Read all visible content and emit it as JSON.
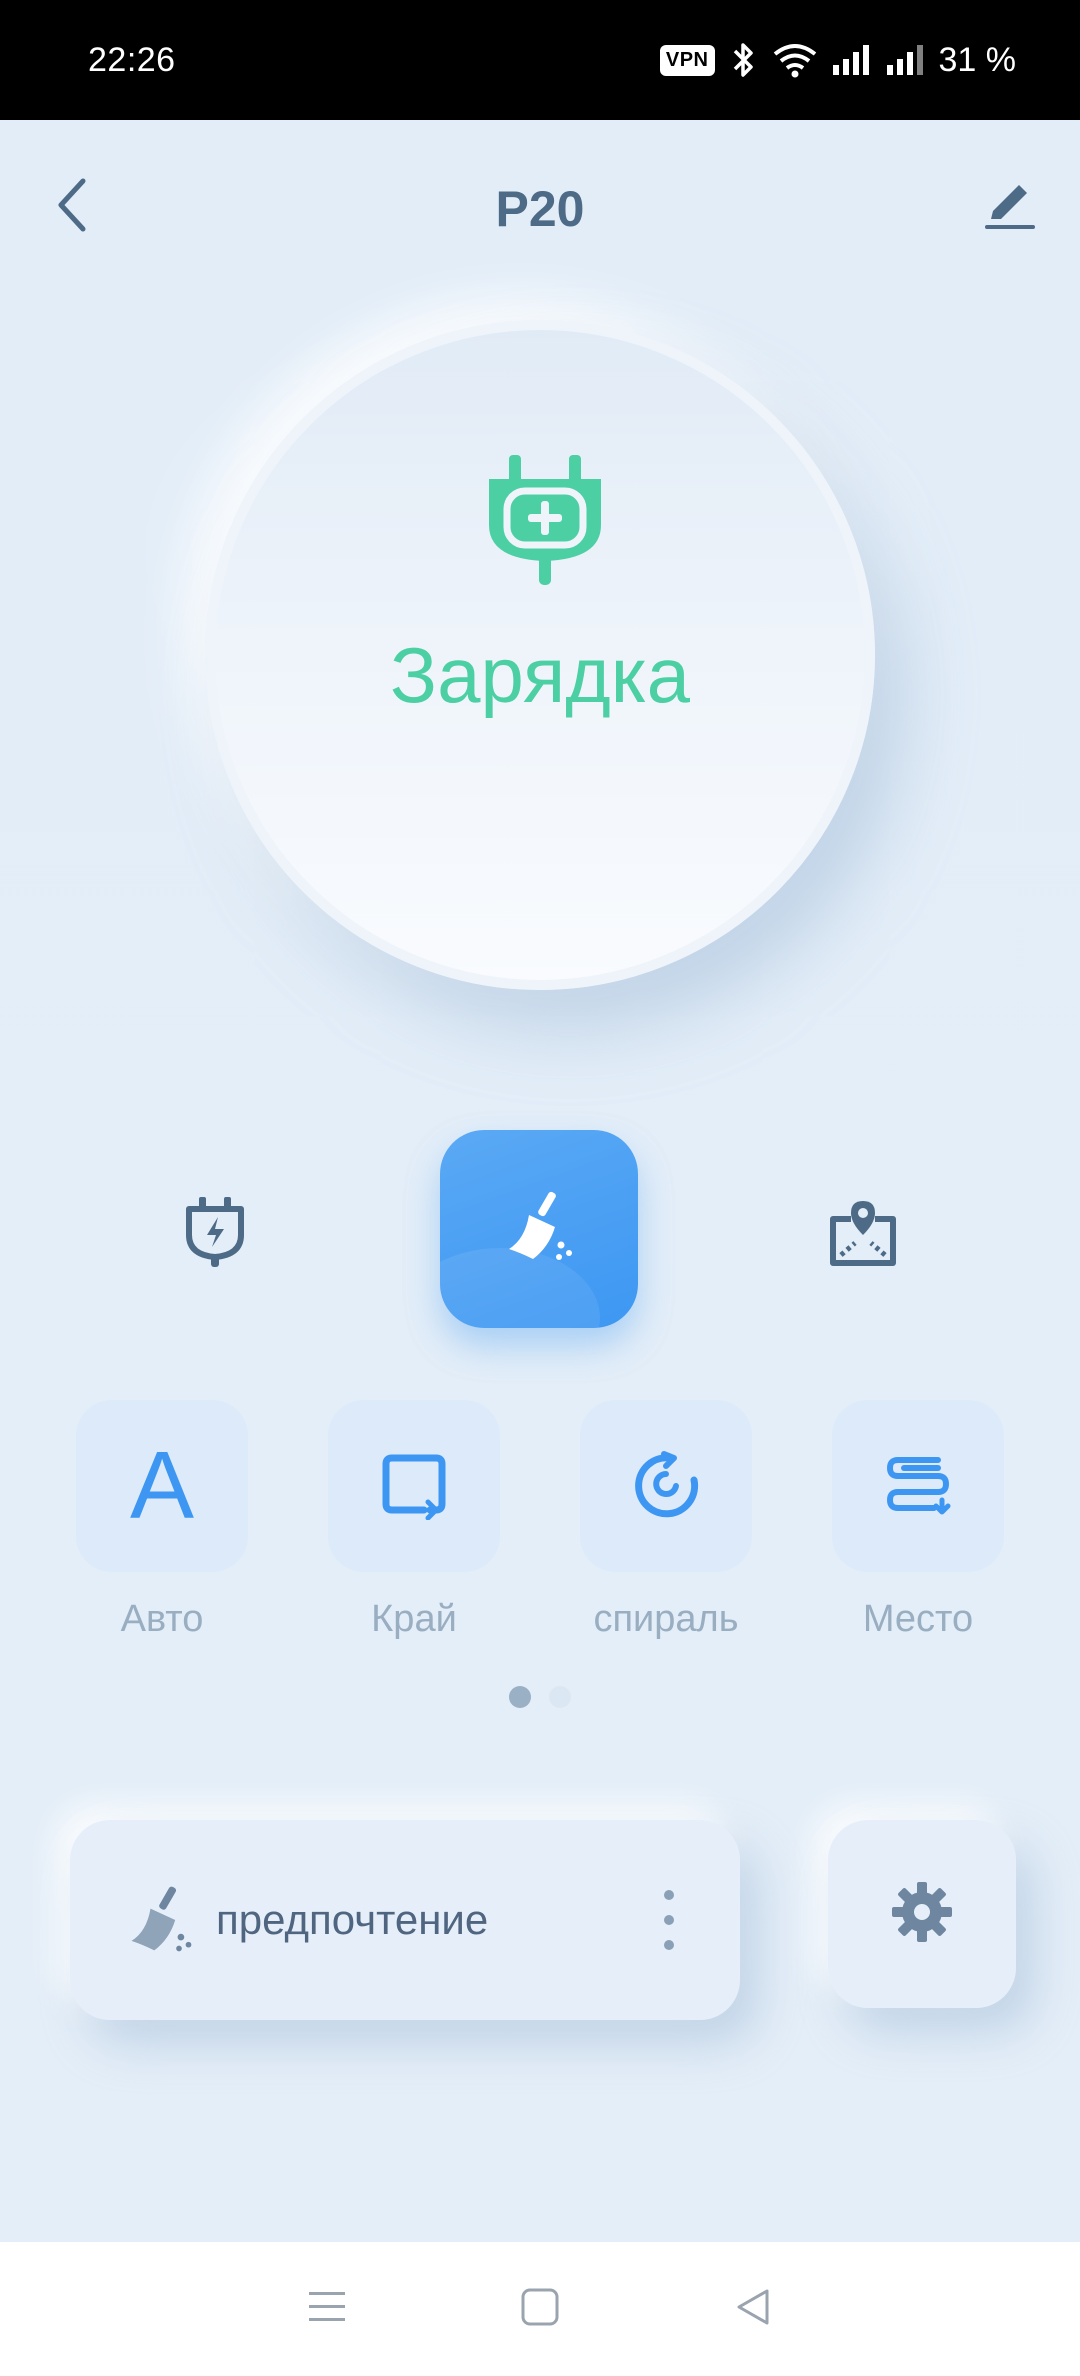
{
  "status_bar": {
    "time": "22:26",
    "vpn": "VPN",
    "battery": "31 %",
    "icons": [
      "bluetooth-icon",
      "wifi-icon",
      "signal-icon",
      "signal-icon"
    ]
  },
  "header": {
    "title": "P20",
    "back_icon": "chevron-left-icon",
    "edit_icon": "pencil-icon"
  },
  "status": {
    "label": "Зарядка",
    "icon": "plug-icon",
    "color": "#4dcfa4"
  },
  "controls": {
    "dock_icon": "charging-dock-icon",
    "clean_icon": "broom-icon",
    "map_icon": "map-pin-icon",
    "accent": "#3d97f2"
  },
  "modes": [
    {
      "label": "Авто",
      "icon": "auto-letter-icon",
      "glyph": "A"
    },
    {
      "label": "Край",
      "icon": "edge-icon"
    },
    {
      "label": "спираль",
      "icon": "spiral-icon"
    },
    {
      "label": "Место",
      "icon": "spot-icon"
    }
  ],
  "pager": {
    "pages": 2,
    "active": 1
  },
  "preference": {
    "label": "предпочтение",
    "icon": "broom-icon",
    "more_icon": "more-vertical-icon"
  },
  "settings": {
    "icon": "gear-icon"
  },
  "nav": {
    "menu_icon": "menu-icon",
    "home_icon": "square-icon",
    "back_icon": "triangle-back-icon"
  }
}
